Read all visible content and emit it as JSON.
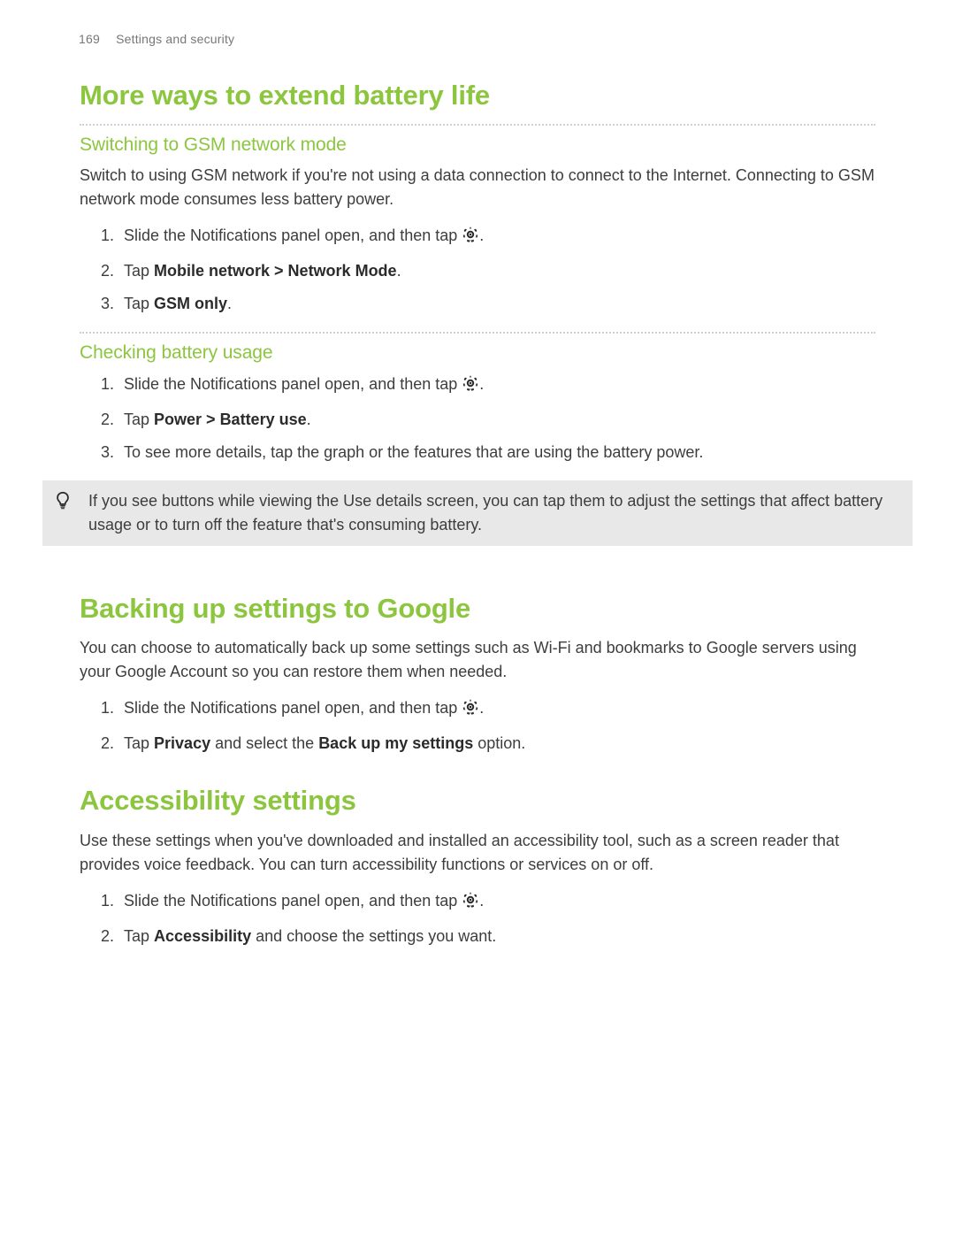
{
  "header": {
    "page_number": "169",
    "section": "Settings and security"
  },
  "s1": {
    "title": "More ways to extend battery life",
    "sub1": {
      "title": "Switching to GSM network mode",
      "body": "Switch to using GSM network if you're not using a data connection to connect to the Internet. Connecting to GSM network mode consumes less battery power.",
      "steps": {
        "a_pre": "Slide the Notifications panel open, and then tap ",
        "a_post": ".",
        "b_pre": "Tap ",
        "b_bold": "Mobile network > Network Mode",
        "b_post": ".",
        "c_pre": "Tap ",
        "c_bold": "GSM only",
        "c_post": "."
      }
    },
    "sub2": {
      "title": "Checking battery usage",
      "steps": {
        "a_pre": "Slide the Notifications panel open, and then tap ",
        "a_post": ".",
        "b_pre": "Tap ",
        "b_bold": "Power > Battery use",
        "b_post": ".",
        "c": "To see more details, tap the graph or the features that are using the battery power."
      }
    },
    "tip": "If you see buttons while viewing the Use details screen, you can tap them to adjust the settings that affect battery usage or to turn off the feature that's consuming battery."
  },
  "s2": {
    "title": "Backing up settings to Google",
    "body": "You can choose to automatically back up some settings such as Wi-Fi and bookmarks to Google servers using your Google Account so you can restore them when needed.",
    "steps": {
      "a_pre": "Slide the Notifications panel open, and then tap ",
      "a_post": ".",
      "b_pre": "Tap ",
      "b_bold1": "Privacy",
      "b_mid": " and select the ",
      "b_bold2": "Back up my settings",
      "b_post": " option."
    }
  },
  "s3": {
    "title": "Accessibility settings",
    "body": "Use these settings when you've downloaded and installed an accessibility tool, such as a screen reader that provides voice feedback. You can turn accessibility functions or services on or off.",
    "steps": {
      "a_pre": "Slide the Notifications panel open, and then tap ",
      "a_post": ".",
      "b_pre": "Tap ",
      "b_bold": "Accessibility",
      "b_post": " and choose the settings you want."
    }
  }
}
